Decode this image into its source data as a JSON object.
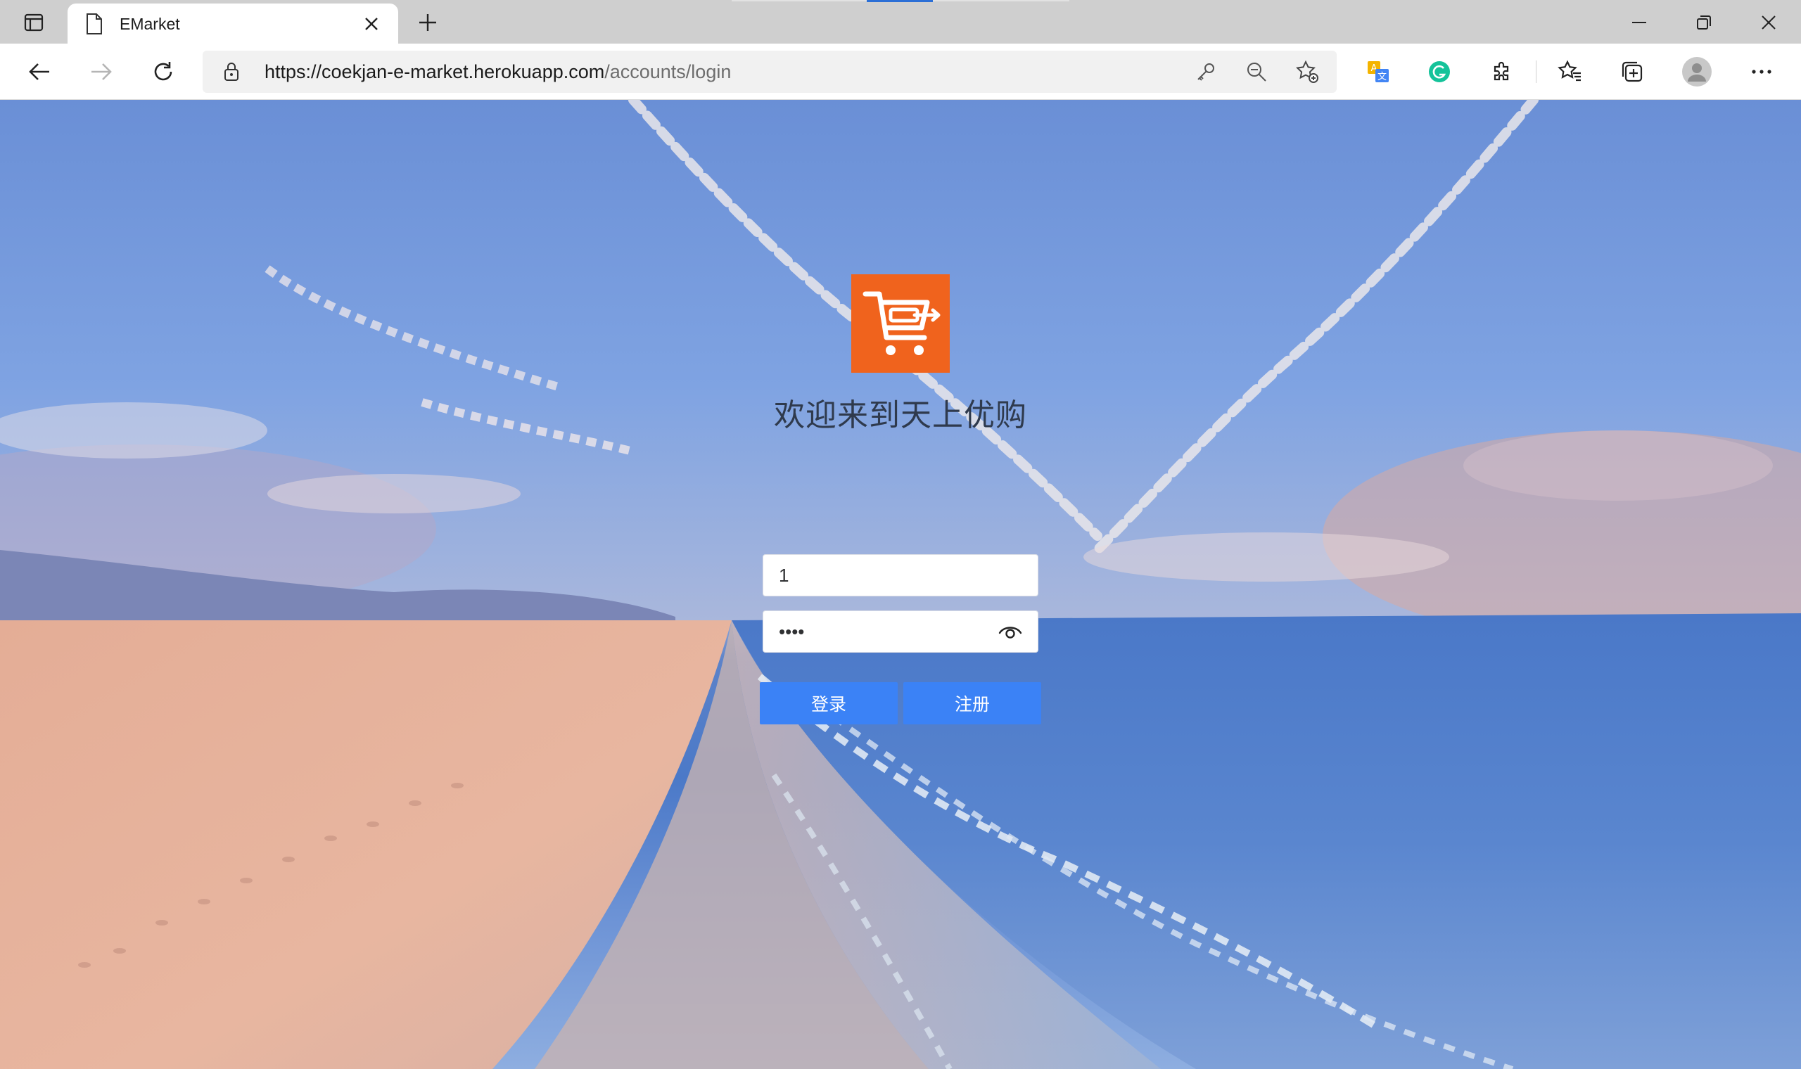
{
  "browser": {
    "tab": {
      "title": "EMarket",
      "page_icon": "page-icon",
      "close_icon": "close-icon"
    },
    "new_tab_icon": "plus-icon",
    "tab_actions_icon": "tab-actions-icon",
    "window_controls": [
      "minimize-icon",
      "restore-icon",
      "close-icon"
    ],
    "nav": {
      "back_icon": "back-arrow-icon",
      "forward_icon": "forward-arrow-icon",
      "refresh_icon": "refresh-icon"
    },
    "address": {
      "lock_icon": "lock-icon",
      "url_host": "https://coekjan-e-market.herokuapp.com",
      "url_path": "/accounts/login",
      "icons": [
        "key-icon",
        "zoom-out-icon",
        "add-favorite-icon"
      ]
    },
    "toolbar_icons": [
      "translate-icon",
      "grammarly-icon",
      "extensions-icon",
      "favorites-icon",
      "collections-icon",
      "profile-avatar",
      "more-icon"
    ],
    "accent": "#2b6fd6"
  },
  "login": {
    "logo_icon": "shopping-cart-icon",
    "logo_color": "#f0631d",
    "welcome": "欢迎来到天上优购",
    "username_value": "1",
    "password_value": "1234",
    "password_toggle_icon": "eye-icon",
    "login_label": "登录",
    "register_label": "注册",
    "button_color": "#3b82f6"
  }
}
